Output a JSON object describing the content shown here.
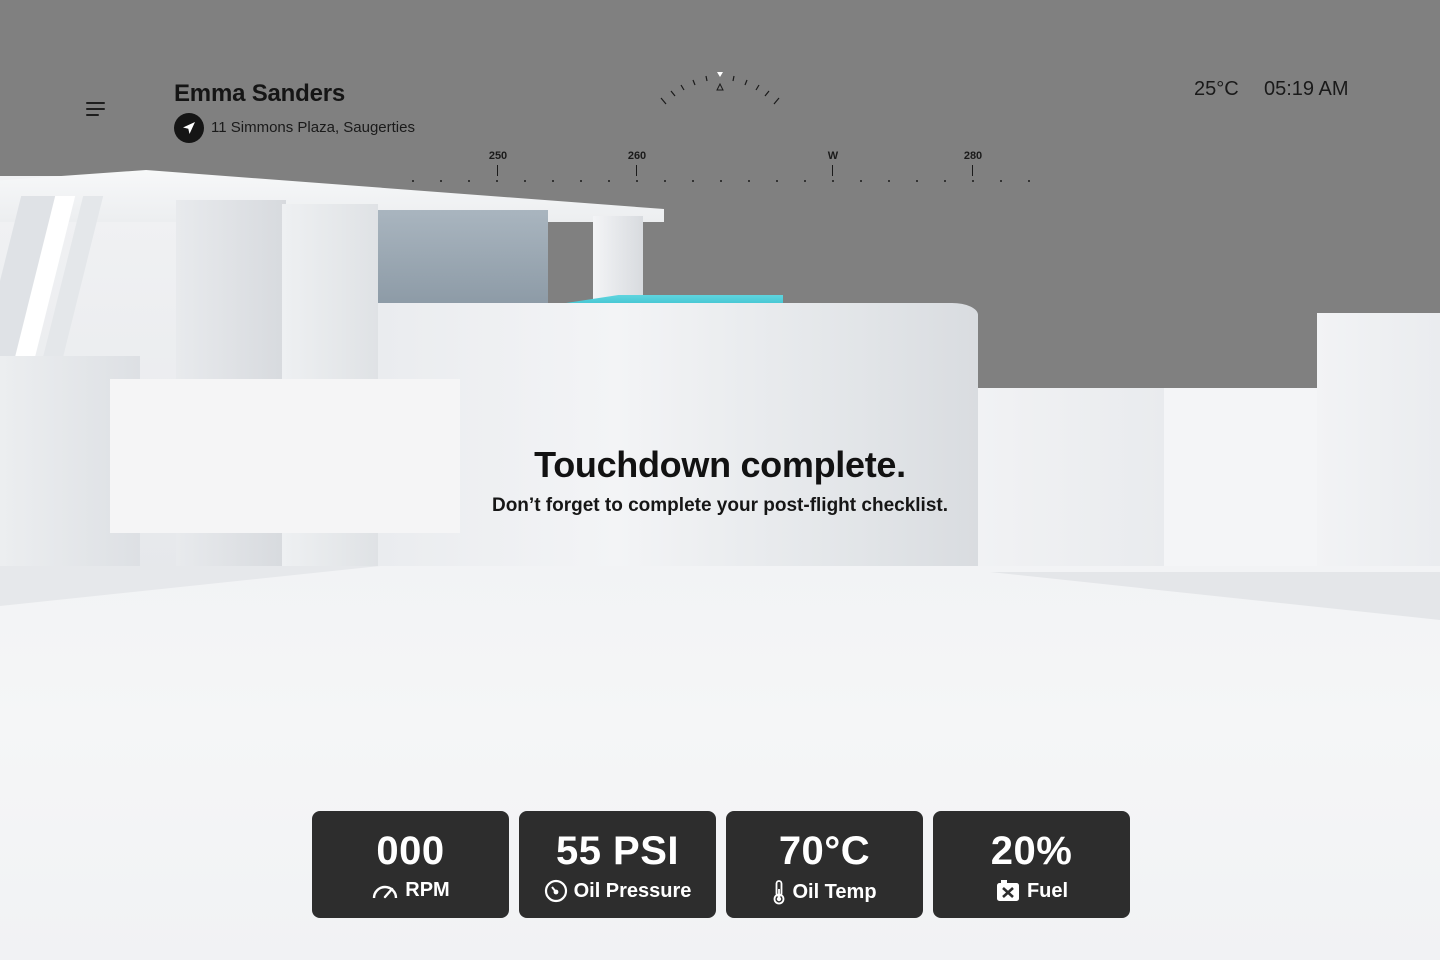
{
  "user": {
    "name": "Emma Sanders",
    "location": "11 Simmons Plaza, Saugerties"
  },
  "status": {
    "temperature": "25°C",
    "time": "05:19 AM"
  },
  "heading": {
    "ticks": [
      {
        "label": "250"
      },
      {
        "label": "260"
      },
      {
        "label": "W"
      },
      {
        "label": "280"
      }
    ]
  },
  "message": {
    "title": "Touchdown complete.",
    "subtitle": "Don’t forget to complete your post-flight checklist."
  },
  "gauges": [
    {
      "value": "000",
      "label": "RPM",
      "icon": "speedometer-icon"
    },
    {
      "value": "55 PSI",
      "label": "Oil Pressure",
      "icon": "oil-pressure-icon"
    },
    {
      "value": "70°C",
      "label": "Oil Temp",
      "icon": "thermometer-icon"
    },
    {
      "value": "20%",
      "label": "Fuel",
      "icon": "fuel-icon"
    }
  ],
  "colors": {
    "sky": "#808080",
    "panel": "#2d2d2d",
    "accent": "#35c6d4"
  }
}
